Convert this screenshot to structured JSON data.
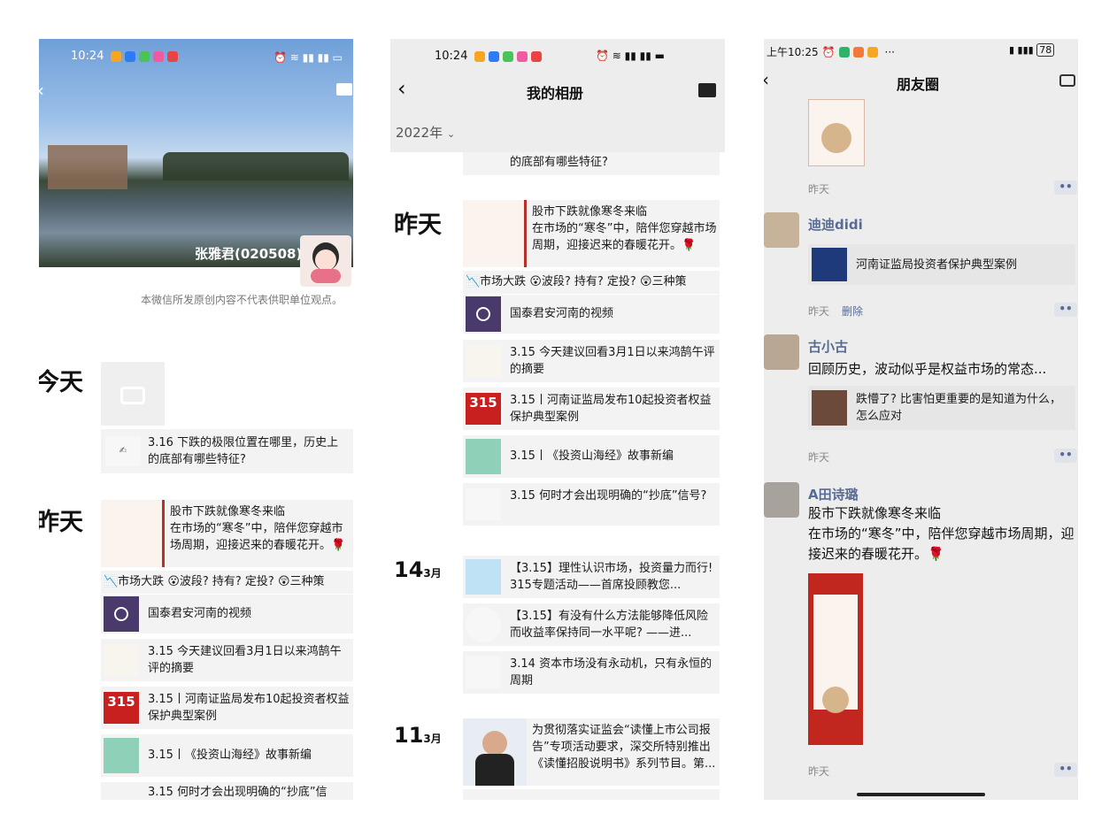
{
  "panel1": {
    "status_time": "10:24",
    "profile_name": "张雅君(020508)",
    "disclaimer": "本微信所发原创内容不代表供职单位观点。",
    "today_label": "今天",
    "yesterday_label": "昨天",
    "items": [
      {
        "text": "3.16 下跌的极限位置在哪里，历史上的底部有哪些特征?"
      },
      {
        "text": "股市下跌就像寒冬来临\n在市场的“寒冬”中，陪伴您穿越市场周期，迎接迟来的春暖花开。🌹"
      },
      {
        "text": "📉市场大跌 😮波段? 持有? 定投? 😲三种策"
      },
      {
        "text": "国泰君安河南的视频"
      },
      {
        "text": "3.15 今天建议回看3月1日以来鸿鹄午评的摘要"
      },
      {
        "text": "3.15丨河南证监局发布10起投资者权益保护典型案例"
      },
      {
        "text": "3.15丨《投资山海经》故事新编"
      },
      {
        "text": "3.15 何时才会出现明确的“抄底”信"
      }
    ]
  },
  "panel2": {
    "status_time": "10:24",
    "title": "我的相册",
    "year_selector": "2022年",
    "top_cut_text": "的底部有哪些特征?",
    "yesterday_label": "昨天",
    "day14": "14",
    "day11": "11",
    "month_suffix": "3月",
    "items": [
      {
        "text": "股市下跌就像寒冬来临\n在市场的“寒冬”中，陪伴您穿越市场周期，迎接迟来的春暖花开。🌹"
      },
      {
        "text": "📉市场大跌 😮波段? 持有? 定投? 😲三种策"
      },
      {
        "text": "国泰君安河南的视频"
      },
      {
        "text": "3.15 今天建议回看3月1日以来鸿鹄午评的摘要"
      },
      {
        "text": "3.15丨河南证监局发布10起投资者权益保护典型案例"
      },
      {
        "text": "3.15丨《投资山海经》故事新编"
      },
      {
        "text": "3.15 何时才会出现明确的“抄底”信号?"
      },
      {
        "text": "【3.15】理性认识市场，投资量力而行! 315专题活动——首席投顾教您..."
      },
      {
        "text": "【3.15】有没有什么方法能够降低风险而收益率保持同一水平呢? ——进..."
      },
      {
        "text": "3.14 资本市场没有永动机，只有永恒的周期"
      },
      {
        "text": "为贯彻落实证监会“读懂上市公司报告”专项活动要求，深交所特别推出《读懂招股说明书》系列节目。第..."
      }
    ]
  },
  "panel3": {
    "status_time": "上午10:25",
    "battery": "78",
    "title": "朋友圈",
    "posts": [
      {
        "time": "昨天"
      },
      {
        "name": "迪迪didi",
        "link": "河南证监局投资者保护典型案例",
        "time": "昨天",
        "delete": "删除"
      },
      {
        "name": "古小古",
        "text": "回顾历史，波动似乎是权益市场的常态...",
        "link": "跌懵了? 比害怕更重要的是知道为什么，怎么应对",
        "time": "昨天"
      },
      {
        "name": "A田诗璐",
        "text": "股市下跌就像寒冬来临\n在市场的“寒冬”中，陪伴您穿越市场周期，迎接迟来的春暖花开。🌹",
        "time": "昨天"
      }
    ],
    "more_symbol": "••"
  },
  "colors": {
    "link_blue": "#576b95",
    "ts_gray": "#8a8a8a",
    "card_bg": "#f3f3f3"
  },
  "icons": [
    "back-icon",
    "message-icon",
    "camera-icon",
    "chevron-down-icon",
    "more-icon"
  ]
}
